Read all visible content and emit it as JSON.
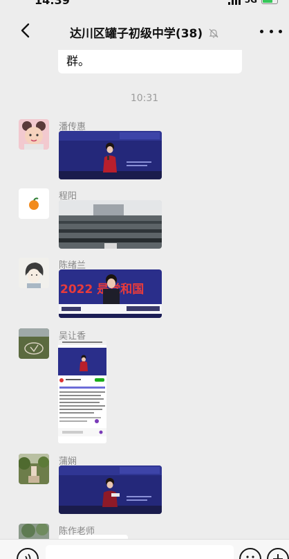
{
  "status_bar": {
    "time": "14:39",
    "network": "5G"
  },
  "header": {
    "title": "达川区罐子初级中学(38)"
  },
  "chat": {
    "partial_message": "群。",
    "timestamp": "10:31",
    "messages": [
      {
        "sender": "潘传惠",
        "type": "video"
      },
      {
        "sender": "程阳",
        "type": "video"
      },
      {
        "sender": "陈绪兰",
        "type": "video",
        "overlay_text": "2022 是党和国"
      },
      {
        "sender": "吴让香",
        "type": "image"
      },
      {
        "sender": "蒲娴",
        "type": "video"
      },
      {
        "sender": "陈作老师",
        "type": "text"
      }
    ]
  },
  "input_bar": {
    "placeholder": ""
  },
  "colors": {
    "background": "#ededed",
    "bubble": "#ffffff",
    "stage_blue": "#24287a"
  }
}
